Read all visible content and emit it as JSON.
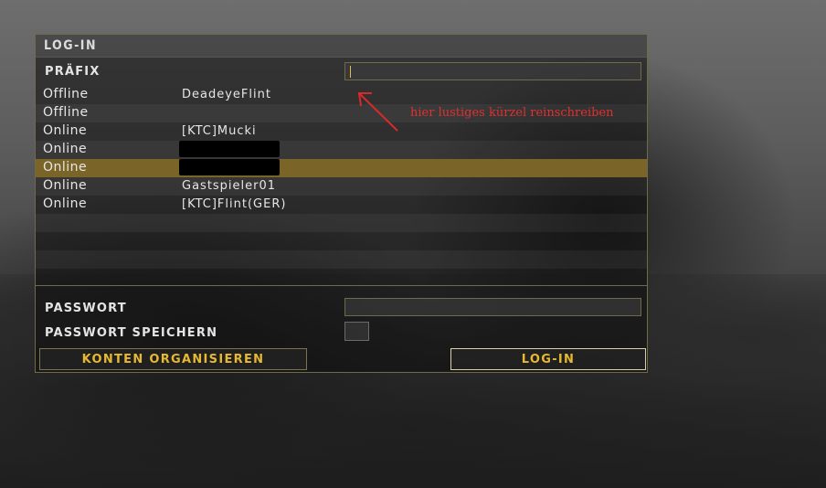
{
  "dialog": {
    "title": "LOG-IN",
    "prefix_label": "PRÄFIX",
    "prefix_value": "",
    "password_label": "PASSWORT",
    "password_value": "",
    "save_password_label": "PASSWORT SPEICHERN",
    "save_password_checked": false,
    "manage_accounts_label": "KONTEN ORGANISIEREN",
    "login_label": "LOG-IN"
  },
  "profiles": [
    {
      "status": "Offline",
      "name": "DeadeyeFlint",
      "redacted": false,
      "selected": false
    },
    {
      "status": "Offline",
      "name": "",
      "redacted": false,
      "selected": false
    },
    {
      "status": "Online",
      "name": "[KTC]Mucki",
      "redacted": false,
      "selected": false
    },
    {
      "status": "Online",
      "name": "",
      "redacted": true,
      "selected": false
    },
    {
      "status": "Online",
      "name": "",
      "redacted": true,
      "selected": true
    },
    {
      "status": "Online",
      "name": "Gastspieler01",
      "redacted": false,
      "selected": false
    },
    {
      "status": "Online",
      "name": "[KTC]Flint(GER)",
      "redacted": false,
      "selected": false
    }
  ],
  "annotation": {
    "text": "hier lustiges kürzel reinschreiben",
    "color": "#e03030"
  },
  "colors": {
    "accent": "#e7b830",
    "selected_row": "#7a6428",
    "border": "#6f6a4a"
  }
}
